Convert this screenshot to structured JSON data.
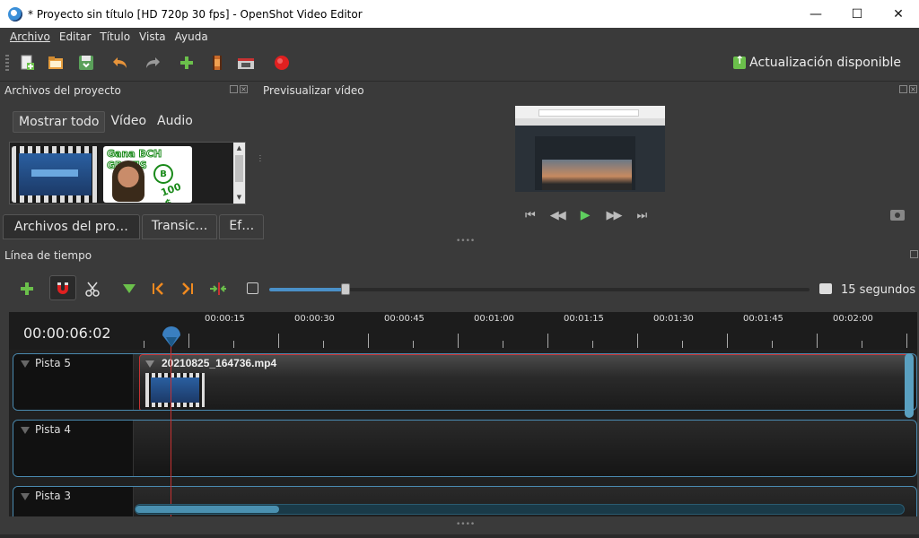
{
  "window": {
    "title": "* Proyecto sin título [HD 720p 30 fps] - OpenShot Video Editor",
    "minimize": "—",
    "maximize": "☐",
    "close": "✕"
  },
  "menu": {
    "items": [
      "Archivo",
      "Editar",
      "Título",
      "Vista",
      "Ayuda"
    ]
  },
  "toolbar": {
    "update_label": "Actualización disponible"
  },
  "project_files": {
    "title": "Archivos del proyecto",
    "filters": [
      "Mostrar todo",
      "Vídeo",
      "Audio"
    ],
    "active_filter": "Mostrar todo",
    "thumb2_text": "Gana BCH GRATIS",
    "thumb2_amount": "100 $"
  },
  "bottom_tabs": [
    "Archivos del pro…",
    "Transic…",
    "Ef…"
  ],
  "preview": {
    "title": "Previsualizar vídeo"
  },
  "timeline": {
    "title": "Línea de tiempo",
    "current_time": "00:00:06:02",
    "zoom_label": "15 segundos",
    "zoom_level": 0.14,
    "ruler_labels": [
      "00:00:15",
      "00:00:30",
      "00:00:45",
      "00:01:00",
      "00:01:15",
      "00:01:30",
      "00:01:45",
      "00:02:00"
    ],
    "tracks": [
      {
        "name": "Pista 5",
        "clip": "20210825_164736.mp4"
      },
      {
        "name": "Pista 4"
      },
      {
        "name": "Pista 3"
      }
    ]
  },
  "colors": {
    "accent": "#4a90c8",
    "playhead": "#c83232",
    "add_green": "#6bc04b",
    "record_red": "#e02020"
  }
}
